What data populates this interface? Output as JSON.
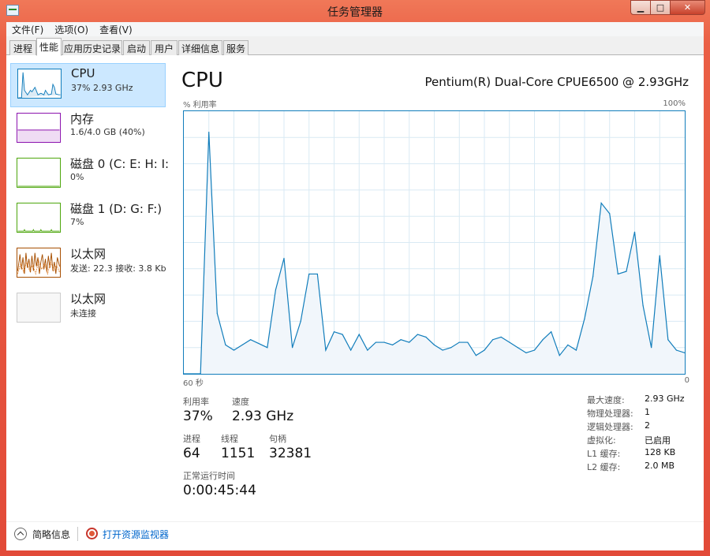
{
  "window": {
    "title": "任务管理器",
    "minimize": "▁",
    "maximize": "□",
    "close": "✕"
  },
  "menu": [
    "文件(F)",
    "选项(O)",
    "查看(V)"
  ],
  "tabs": [
    "进程",
    "性能",
    "应用历史记录",
    "启动",
    "用户",
    "详细信息",
    "服务"
  ],
  "active_tab": "性能",
  "sidebar": {
    "items": [
      {
        "title": "CPU",
        "sub": "37% 2.93 GHz",
        "color": "#117dbb"
      },
      {
        "title": "内存",
        "sub": "1.6/4.0 GB (40%)",
        "color": "#8b12ae"
      },
      {
        "title": "磁盘 0 (C: E: H: I:",
        "sub": "0%",
        "color": "#4da60c"
      },
      {
        "title": "磁盘 1 (D: G: F:)",
        "sub": "7%",
        "color": "#4da60c"
      },
      {
        "title": "以太网",
        "sub": "发送: 22.3  接收: 3.8 Kb",
        "color": "#a74f01"
      },
      {
        "title": "以太网",
        "sub": "未连接",
        "color": "#cccccc"
      }
    ]
  },
  "main": {
    "heading": "CPU",
    "model": "Pentium(R) Dual-Core CPUE6500 @ 2.93GHz",
    "y_label": "% 利用率",
    "y_max_label": "100%",
    "x_left_label": "60 秒",
    "x_right_label": "0"
  },
  "chart_data": {
    "type": "area",
    "x_unit": "秒",
    "xlim": [
      60,
      0
    ],
    "ylim": [
      0,
      100
    ],
    "grid": true,
    "color": "#117dbb",
    "fill": "#f1f6fb",
    "x": [
      60,
      58,
      57,
      56,
      55,
      54,
      53,
      52,
      50,
      49,
      48,
      47,
      46,
      45,
      44,
      43,
      42,
      41,
      40,
      39,
      38,
      37,
      36,
      35,
      34,
      33,
      32,
      31,
      30,
      29,
      28,
      27,
      26,
      25,
      24,
      23,
      22,
      21,
      20,
      19,
      18,
      17,
      16,
      15,
      14,
      13,
      12,
      11,
      10,
      9,
      8,
      7,
      6,
      5,
      4,
      3,
      2,
      1,
      0
    ],
    "values": [
      0,
      0,
      92,
      23,
      11,
      9,
      11,
      13,
      10,
      32,
      44,
      10,
      20,
      38,
      38,
      9,
      16,
      15,
      9,
      15,
      9,
      12,
      12,
      11,
      13,
      12,
      15,
      14,
      11,
      9,
      10,
      12,
      12,
      7,
      9,
      13,
      14,
      12,
      10,
      8,
      9,
      13,
      16,
      7,
      11,
      9,
      21,
      37,
      65,
      61,
      38,
      39,
      54,
      26,
      10,
      45,
      13,
      9,
      8
    ]
  },
  "stats": {
    "utilization_label": "利用率",
    "utilization": "37%",
    "speed_label": "速度",
    "speed": "2.93 GHz",
    "processes_label": "进程",
    "processes": "64",
    "threads_label": "线程",
    "threads": "1151",
    "handles_label": "句柄",
    "handles": "32381",
    "uptime_label": "正常运行时间",
    "uptime": "0:00:45:44"
  },
  "specs": [
    {
      "label": "最大速度:",
      "value": "2.93 GHz"
    },
    {
      "label": "物理处理器:",
      "value": "1"
    },
    {
      "label": "逻辑处理器:",
      "value": "2"
    },
    {
      "label": "虚拟化:",
      "value": "已启用"
    },
    {
      "label": "L1 缓存:",
      "value": "128 KB"
    },
    {
      "label": "L2 缓存:",
      "value": "2.0 MB"
    }
  ],
  "footer": {
    "less_details": "简略信息",
    "open_monitor": "打开资源监视器"
  }
}
